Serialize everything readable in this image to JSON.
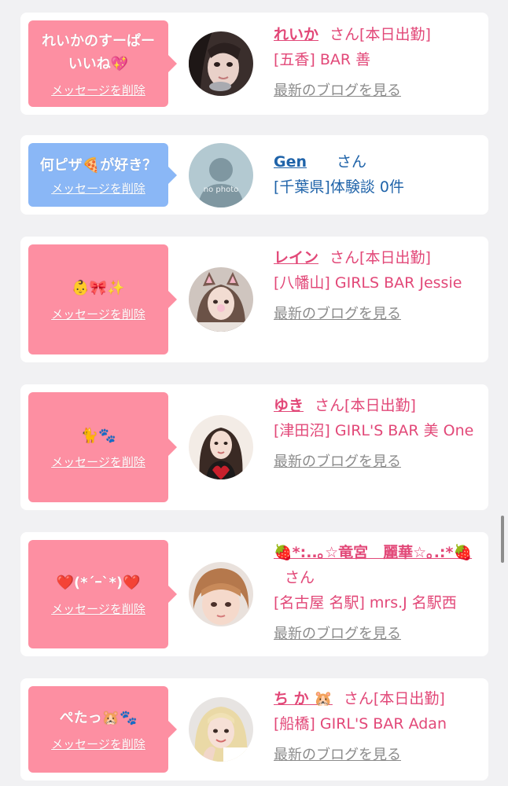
{
  "delete_label": "メッセージを削除",
  "blog_label": "最新のブログを見る",
  "san": "さん",
  "cards": [
    {
      "bubble": "れいかのすーぱー\nいいね💖",
      "name": "れいか",
      "status": "[本日出勤]",
      "shop": "[五香] BAR 善",
      "blog": "最新のブログを見る"
    },
    {
      "bubble": "何ピザ🍕が好き？",
      "name": "Gen",
      "status": "",
      "shop": "[千葉県]体験談 0件",
      "avatar_text": "no photo"
    },
    {
      "bubble": "👶🎀✨",
      "name": "レイン",
      "status": "[本日出勤]",
      "shop": "[八幡山] GIRLS BAR Jessie",
      "blog": "最新のブログを見る"
    },
    {
      "bubble": "🐈🐾",
      "name": "ゆき",
      "status": "[本日出勤]",
      "shop": "[津田沼] GIRL'S BAR 美 One",
      "blog": "最新のブログを見る"
    },
    {
      "bubble": "❤️(*´ｰ`*)❤️",
      "name": "🍓*:..｡☆竜宮　麗華☆｡.:*🍓",
      "status": "",
      "shop": "[名古屋 名駅] mrs.J 名駅西",
      "blog": "最新のブログを見る"
    },
    {
      "bubble": "ぺたっ🐹🐾",
      "name": "ち か 🐹",
      "status": "[本日出勤]",
      "shop": "[船橋] GIRL'S BAR Adan",
      "blog": "最新のブログを見る"
    }
  ],
  "colors": {
    "bubble_pink": "#fd8fa2",
    "bubble_blue": "#8ab7f6",
    "name_pink": "#e24878",
    "name_blue": "#1f63a9",
    "blog_gray": "#8b8b8b",
    "page_bg": "#f1f1f3"
  }
}
